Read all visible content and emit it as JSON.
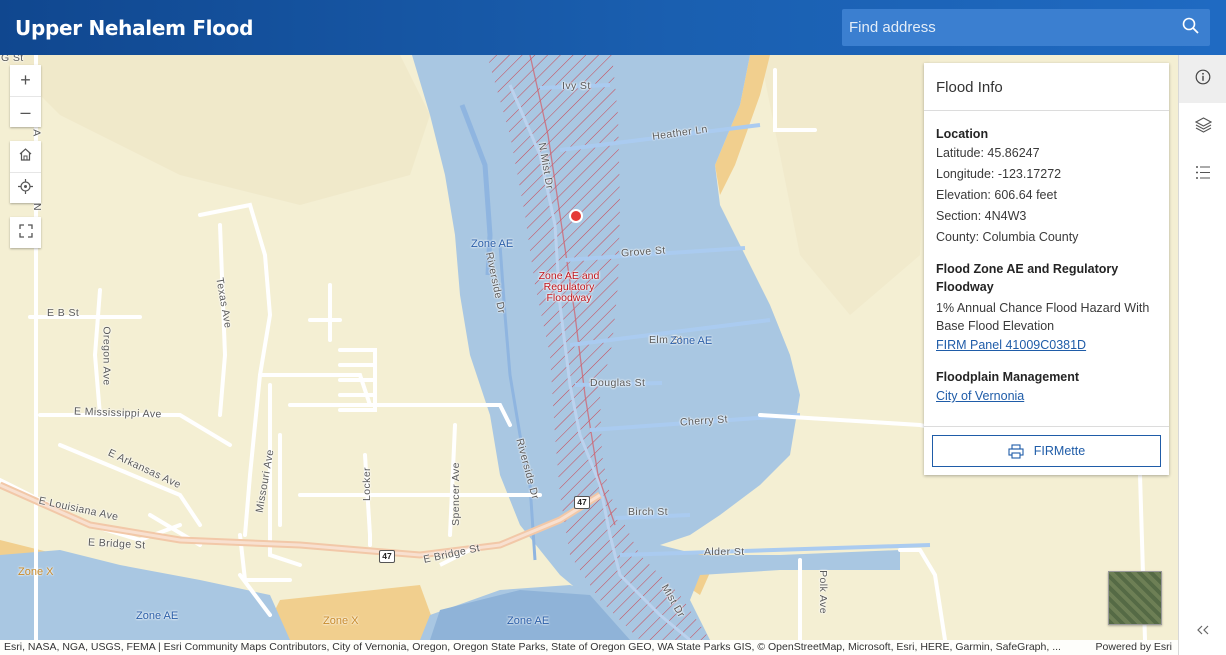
{
  "header": {
    "title": "Upper Nehalem Flood"
  },
  "search": {
    "placeholder": "Find address"
  },
  "controls": {
    "zoom_in": "+",
    "zoom_out": "–"
  },
  "colors": {
    "header": "#1a5fb0",
    "flood_zone_ae": "#a9c7e2",
    "floodway_hatch": "#d0303a",
    "zone_x": "#f1cf8e",
    "marker": "#e53935"
  },
  "icons": [
    "search-icon",
    "home-icon",
    "locate-icon",
    "fullscreen-icon",
    "info-icon",
    "layers-icon",
    "list-icon",
    "printer-icon",
    "chevrons-left-icon"
  ],
  "map": {
    "streets": {
      "ivy": "Ivy St",
      "heather": "Heather Ln",
      "grove": "Grove St",
      "elm": "Elm St",
      "douglas": "Douglas St",
      "cherry": "Cherry St",
      "birch": "Birch St",
      "alder": "Alder St",
      "n_mist": "N Mist Dr",
      "riverside1": "Riverside Dr",
      "riverside2": "Riverside Dr",
      "mist": "Mist Dr",
      "e_b": "E B St",
      "oregon": "Oregon Ave",
      "texas": "Texas Ave",
      "e_mississippi": "E Mississippi Ave",
      "e_arkansas": "E Arkansas Ave",
      "e_louisiana": "E Louisiana Ave",
      "missouri": "Missouri Ave",
      "locker": "Locker",
      "spencer": "Spencer Ave",
      "e_bridge1": "E Bridge St",
      "e_bridge2": "E Bridge St",
      "polk": "Polk Ave",
      "edge_g": "G St",
      "edge_a": "A",
      "edge_n": "N"
    },
    "zones": {
      "ae1": "Zone AE",
      "ae2": "Zone AE",
      "ae3": "Zone AE",
      "ae4": "Zone AE",
      "x1": "Zone X",
      "x2": "Zone X",
      "floodway": "Zone AE and Regulatory Floodway"
    },
    "route_shields": {
      "s1": "47",
      "s2": "47"
    }
  },
  "panel": {
    "title": "Flood Info",
    "location": {
      "heading": "Location",
      "latitude": "Latitude: 45.86247",
      "longitude": "Longitude: -123.17272",
      "elevation": "Elevation: 606.64 feet",
      "section": "Section: 4N4W3",
      "county": "County: Columbia County"
    },
    "zone": {
      "heading": "Flood Zone AE and Regulatory Floodway",
      "description": "1% Annual Chance Flood Hazard With Base Flood Elevation",
      "firm_link": "FIRM Panel 41009C0381D"
    },
    "floodplain": {
      "heading": "Floodplain Management",
      "link": "City of Vernonia"
    },
    "button": "FIRMette"
  },
  "attribution": {
    "text": "Esri, NASA, NGA, USGS, FEMA | Esri Community Maps Contributors, City of Vernonia, Oregon, Oregon State Parks, State of Oregon GEO, WA State Parks GIS, © OpenStreetMap, Microsoft, Esri, HERE, Garmin, SafeGraph, ...",
    "powered": "Powered by Esri"
  }
}
